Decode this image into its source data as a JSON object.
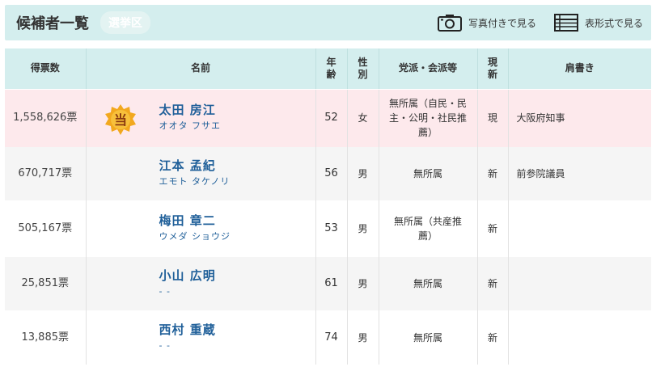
{
  "header": {
    "title": "候補者一覧",
    "badge": "選挙区",
    "photo_view_label": "写真付きで見る",
    "table_view_label": "表形式で見る"
  },
  "colors": {
    "header_bg": "#d4eeee",
    "winner_row_bg": "#fde9ec",
    "name_link": "#1f5f99",
    "winner_badge": "#f2a81e"
  },
  "table": {
    "columns": {
      "votes": "得票数",
      "name": "名前",
      "age": "年\n齢",
      "gender": "性\n別",
      "party": "党派・会派等",
      "status": "現\n新",
      "title": "肩書き"
    },
    "rows": [
      {
        "votes": "1,558,626票",
        "winner": true,
        "winner_mark": "当",
        "name": "太田 房江",
        "kana": "オオタ フサエ",
        "age": "52",
        "gender": "女",
        "party": "無所属（自民・民主・公明・社民推薦）",
        "status": "現",
        "title": "大阪府知事"
      },
      {
        "votes": "670,717票",
        "winner": false,
        "name": "江本 孟紀",
        "kana": "エモト タケノリ",
        "age": "56",
        "gender": "男",
        "party": "無所属",
        "status": "新",
        "title": "前参院議員"
      },
      {
        "votes": "505,167票",
        "winner": false,
        "name": "梅田 章二",
        "kana": "ウメダ ショウジ",
        "age": "53",
        "gender": "男",
        "party": "無所属（共産推薦）",
        "status": "新",
        "title": ""
      },
      {
        "votes": "25,851票",
        "winner": false,
        "name": "小山 広明",
        "kana": "- -",
        "age": "61",
        "gender": "男",
        "party": "無所属",
        "status": "新",
        "title": ""
      },
      {
        "votes": "13,885票",
        "winner": false,
        "name": "西村 重蔵",
        "kana": "- -",
        "age": "74",
        "gender": "男",
        "party": "無所属",
        "status": "新",
        "title": ""
      }
    ]
  }
}
